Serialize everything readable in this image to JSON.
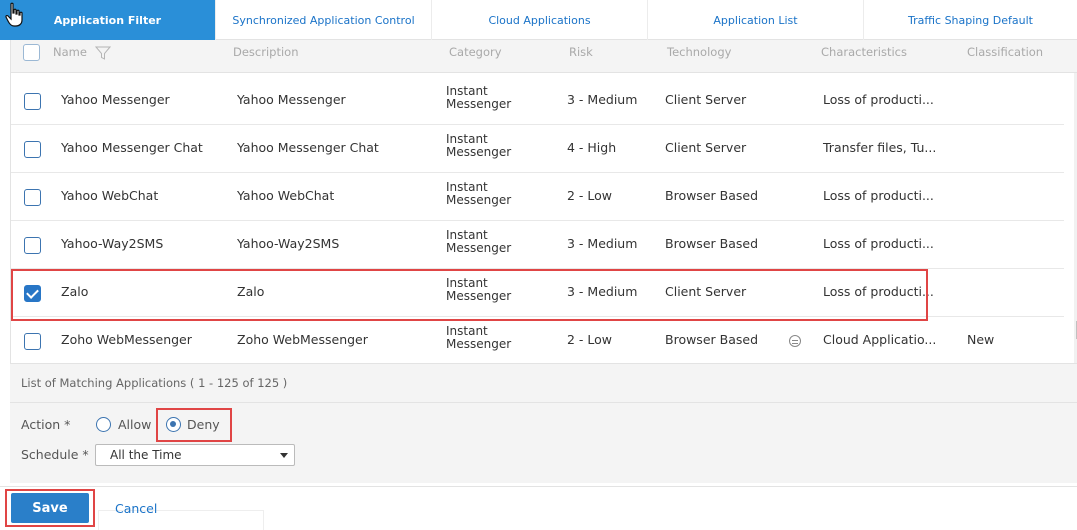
{
  "tabs": [
    {
      "label": "Application Filter"
    },
    {
      "label": "Synchronized Application Control"
    },
    {
      "label": "Cloud Applications"
    },
    {
      "label": "Application List"
    },
    {
      "label": "Traffic Shaping Default"
    }
  ],
  "columns": {
    "name": "Name",
    "description": "Description",
    "category": "Category",
    "risk": "Risk",
    "technology": "Technology",
    "characteristics": "Characteristics",
    "classification": "Classification"
  },
  "rows": [
    {
      "name": "Yahoo Messenger",
      "description": "Yahoo Messenger",
      "category_1": "Instant",
      "category_2": "Messenger",
      "risk": "3 - Medium",
      "technology": "Client Server",
      "characteristics": "Loss of producti...",
      "classification": "",
      "checked": false
    },
    {
      "name": "Yahoo Messenger Chat",
      "description": "Yahoo Messenger Chat",
      "category_1": "Instant",
      "category_2": "Messenger",
      "risk": "4 - High",
      "technology": "Client Server",
      "characteristics": "Transfer files, Tu...",
      "classification": "",
      "checked": false
    },
    {
      "name": "Yahoo WebChat",
      "description": "Yahoo WebChat",
      "category_1": "Instant",
      "category_2": "Messenger",
      "risk": "2 - Low",
      "technology": "Browser Based",
      "characteristics": "Loss of producti...",
      "classification": "",
      "checked": false
    },
    {
      "name": "Yahoo-Way2SMS",
      "description": "Yahoo-Way2SMS",
      "category_1": "Instant",
      "category_2": "Messenger",
      "risk": "3 - Medium",
      "technology": "Browser Based",
      "characteristics": "Loss of producti...",
      "classification": "",
      "checked": false
    },
    {
      "name": "Zalo",
      "description": "Zalo",
      "category_1": "Instant",
      "category_2": "Messenger",
      "risk": "3 - Medium",
      "technology": "Client Server",
      "characteristics": "Loss of producti...",
      "classification": "",
      "checked": true
    },
    {
      "name": "Zoho WebMessenger",
      "description": "Zoho WebMessenger",
      "category_1": "Instant",
      "category_2": "Messenger",
      "risk": "2 - Low",
      "technology": "Browser Based",
      "characteristics": "Cloud Applicatio...",
      "classification": "New",
      "checked": false
    }
  ],
  "matching_text": "List of Matching Applications ( 1 - 125 of 125 )",
  "form": {
    "action_label": "Action *",
    "allow_label": "Allow",
    "deny_label": "Deny",
    "selected_action": "Deny",
    "schedule_label": "Schedule *",
    "schedule_value": "All the Time"
  },
  "buttons": {
    "save": "Save",
    "cancel": "Cancel"
  },
  "colors": {
    "accent": "#2a8fd8",
    "highlight": "#e04545"
  }
}
